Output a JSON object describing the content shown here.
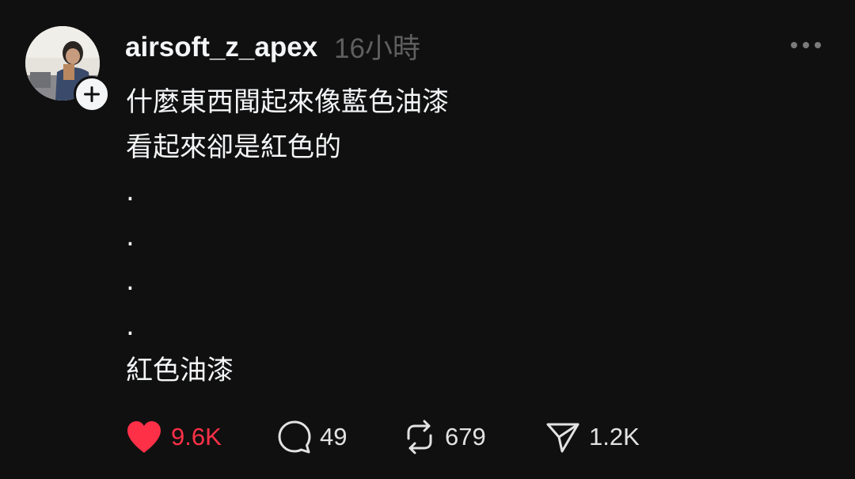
{
  "post": {
    "username": "airsoft_z_apex",
    "timestamp": "16小時",
    "lines": [
      "什麼東西聞起來像藍色油漆",
      "看起來卻是紅色的",
      ".",
      ".",
      ".",
      ".",
      "紅色油漆"
    ]
  },
  "actions": {
    "likes": "9.6K",
    "replies": "49",
    "reposts": "679",
    "shares": "1.2K"
  },
  "colors": {
    "background": "#101010",
    "text": "#f3f5f7",
    "muted": "#5f5f5f",
    "like": "#fe3047"
  },
  "icons": {
    "more": "more-horizontal-icon",
    "follow": "plus-icon",
    "like": "heart-filled-icon",
    "reply": "speech-bubble-icon",
    "repost": "repost-icon",
    "share": "paper-plane-icon"
  }
}
